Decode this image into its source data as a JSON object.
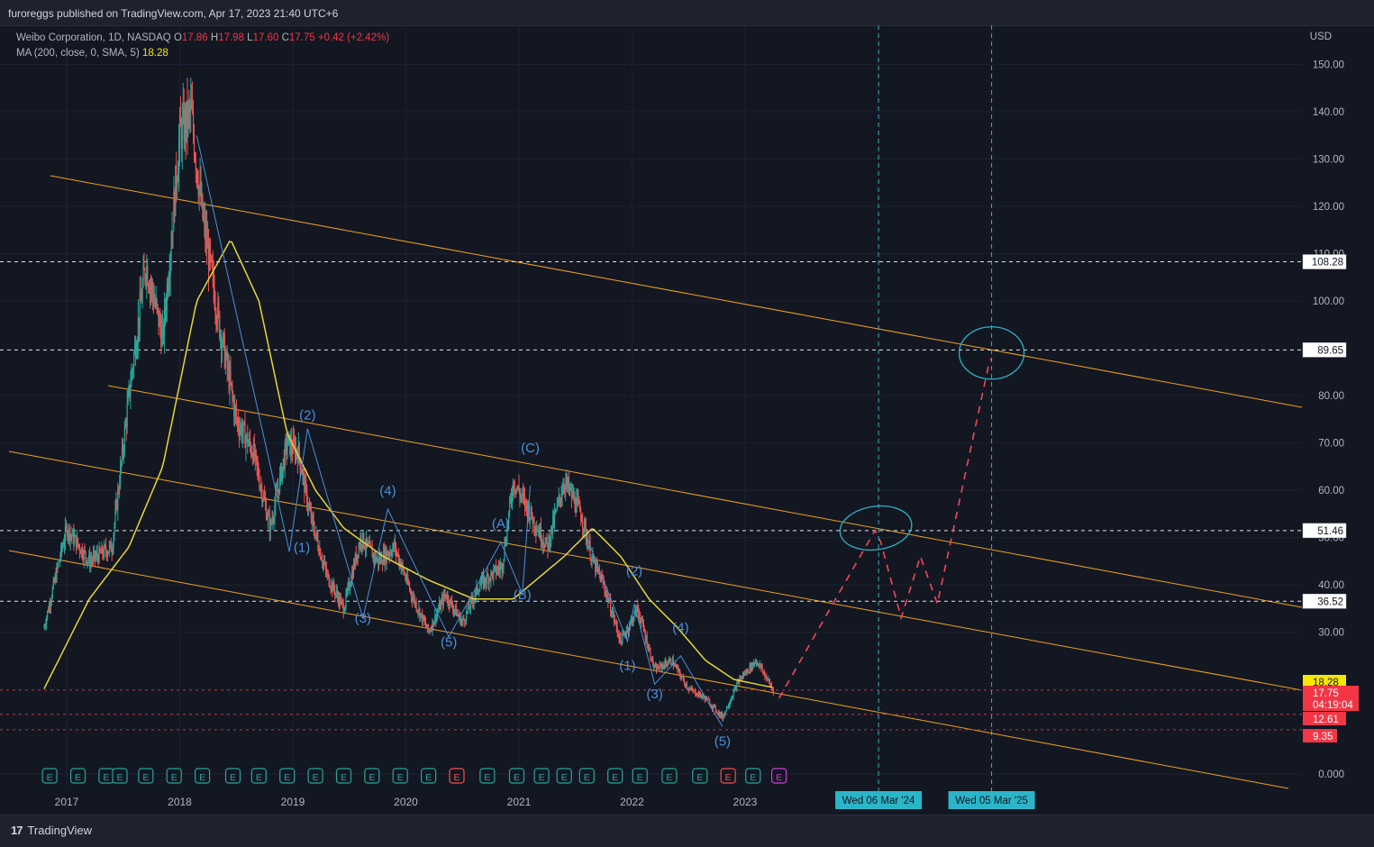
{
  "header": {
    "published": "furoreggs published on TradingView.com, Apr 17, 2023 21:40 UTC+6"
  },
  "legend": {
    "symbol": "Weibo Corporation, 1D, NASDAQ",
    "o_label": "O",
    "o_val": "17.86",
    "h_label": "H",
    "h_val": "17.98",
    "l_label": "L",
    "l_val": "17.60",
    "c_label": "C",
    "c_val": "17.75",
    "change": "+0.42 (+2.42%)",
    "ma_label": "MA (200, close, 0, SMA, 5)",
    "ma_val": "18.28"
  },
  "footer": {
    "brand": "TradingView"
  },
  "colors": {
    "background": "#131722",
    "up": "#26a69a",
    "down": "#ef5350",
    "ma": "#e6d733",
    "channel": "#f0a020",
    "wave": "#4a90d9",
    "projection": "#f2485a",
    "vline": "#2bb5c8",
    "circle": "#2bb5c8"
  },
  "chart_data": {
    "type": "line",
    "title": "",
    "xlabel": "",
    "ylabel": "USD",
    "currency": "USD",
    "x_ticks": [
      "2017",
      "2018",
      "2019",
      "2020",
      "2021",
      "2022",
      "2023"
    ],
    "ylim": [
      0,
      155
    ],
    "y_ticks": [
      0,
      30,
      40,
      50,
      60,
      70,
      80,
      100,
      110,
      120,
      130,
      140,
      150
    ],
    "y_tick_labels": [
      "0.000",
      "30.00",
      "40.00",
      "50.00",
      "60.00",
      "70.00",
      "80.00",
      "100.00",
      "110.00",
      "120.00",
      "130.00",
      "140.00",
      "150.00"
    ],
    "series": [
      {
        "type": "candlestick",
        "x": [
          2016.8,
          2017.0,
          2017.2,
          2017.4,
          2017.55,
          2017.7,
          2017.85,
          2018.0,
          2018.1,
          2018.2,
          2018.35,
          2018.5,
          2018.65,
          2018.8,
          2018.95,
          2019.05,
          2019.15,
          2019.3,
          2019.45,
          2019.6,
          2019.75,
          2019.9,
          2020.05,
          2020.2,
          2020.35,
          2020.5,
          2020.65,
          2020.85,
          2020.95,
          2021.1,
          2021.25,
          2021.4,
          2021.55,
          2021.65,
          2021.75,
          2021.9,
          2022.05,
          2022.2,
          2022.35,
          2022.5,
          2022.65,
          2022.8,
          2022.95,
          2023.1,
          2023.25
        ],
        "values": [
          31,
          52,
          45,
          48,
          80,
          108,
          92,
          135,
          140,
          118,
          95,
          75,
          68,
          52,
          70,
          68,
          55,
          42,
          35,
          50,
          45,
          48,
          38,
          30,
          38,
          32,
          40,
          44,
          62,
          55,
          48,
          62,
          55,
          45,
          40,
          28,
          35,
          22,
          24,
          18,
          16,
          12,
          20,
          24,
          17.75
        ]
      },
      {
        "name": "MA (200, close, 0, SMA, 5)",
        "type": "line",
        "x": [
          2016.8,
          2017.2,
          2017.55,
          2017.85,
          2018.15,
          2018.45,
          2018.7,
          2018.95,
          2019.2,
          2019.45,
          2019.8,
          2020.2,
          2020.6,
          2020.95,
          2021.2,
          2021.4,
          2021.65,
          2021.9,
          2022.15,
          2022.4,
          2022.65,
          2022.9,
          2023.1,
          2023.25
        ],
        "values": [
          18,
          37,
          48,
          65,
          100,
          113,
          100,
          72,
          60,
          52,
          46,
          41,
          37,
          37,
          42,
          46,
          52,
          46,
          37,
          31,
          24,
          20,
          19,
          18.28
        ]
      }
    ],
    "price_levels": [
      {
        "label": "108.28",
        "value": 108.28,
        "style": "dashed"
      },
      {
        "label": "89.65",
        "value": 89.65,
        "style": "dashed"
      },
      {
        "label": "51.46",
        "value": 51.46,
        "style": "dashed"
      },
      {
        "label": "36.52",
        "value": 36.52,
        "style": "dashed"
      }
    ],
    "price_tags": [
      {
        "label": "18.28",
        "value": 18.28,
        "kind": "ma"
      },
      {
        "label": "17.75",
        "sub": "04:19:04",
        "value": 17.75,
        "kind": "last"
      },
      {
        "label": "12.61",
        "value": 12.61,
        "kind": "level"
      },
      {
        "label": "9.35",
        "value": 9.35,
        "kind": "level"
      }
    ],
    "date_markers": [
      {
        "label": "Wed 06 Mar '24",
        "x": 2024.18
      },
      {
        "label": "Wed 05 Mar '25",
        "x": 2025.18
      }
    ],
    "wave_labels": [
      {
        "text": "(2)",
        "x": 2019.13,
        "y": 75
      },
      {
        "text": "(1)",
        "x": 2019.08,
        "y": 47
      },
      {
        "text": "(3)",
        "x": 2019.62,
        "y": 32
      },
      {
        "text": "(4)",
        "x": 2019.84,
        "y": 59
      },
      {
        "text": "(5)",
        "x": 2020.38,
        "y": 27
      },
      {
        "text": "(A)",
        "x": 2020.84,
        "y": 52
      },
      {
        "text": "(B)",
        "x": 2021.03,
        "y": 37
      },
      {
        "text": "(C)",
        "x": 2021.1,
        "y": 68
      },
      {
        "text": "(2)",
        "x": 2022.02,
        "y": 42
      },
      {
        "text": "(1)",
        "x": 2021.96,
        "y": 22
      },
      {
        "text": "(3)",
        "x": 2022.2,
        "y": 16
      },
      {
        "text": "(4)",
        "x": 2022.43,
        "y": 30
      },
      {
        "text": "(5)",
        "x": 2022.8,
        "y": 6
      }
    ],
    "projection": {
      "x": [
        2023.3,
        2023.8,
        2024.15,
        2024.2,
        2024.38,
        2024.55,
        2024.7,
        2025.15,
        2025.18
      ],
      "values": [
        16,
        37,
        51.5,
        49,
        33,
        46,
        36,
        86,
        88
      ]
    },
    "events": {
      "x": [
        2016.85,
        2017.1,
        2017.35,
        2017.47,
        2017.7,
        2017.95,
        2018.2,
        2018.47,
        2018.7,
        2018.95,
        2019.2,
        2019.45,
        2019.7,
        2019.95,
        2020.2,
        2020.45,
        2020.72,
        2020.98,
        2021.2,
        2021.4,
        2021.6,
        2021.85,
        2022.07,
        2022.33,
        2022.6,
        2022.85,
        2023.07,
        2023.3
      ],
      "kind": [
        "e",
        "e",
        "e",
        "e",
        "e",
        "e",
        "e",
        "e",
        "e",
        "e",
        "e",
        "e",
        "e",
        "e",
        "e",
        "E",
        "e",
        "e",
        "e",
        "e",
        "e",
        "e",
        "e",
        "e",
        "e",
        "E",
        "e",
        "e2"
      ],
      "label": "E"
    }
  }
}
